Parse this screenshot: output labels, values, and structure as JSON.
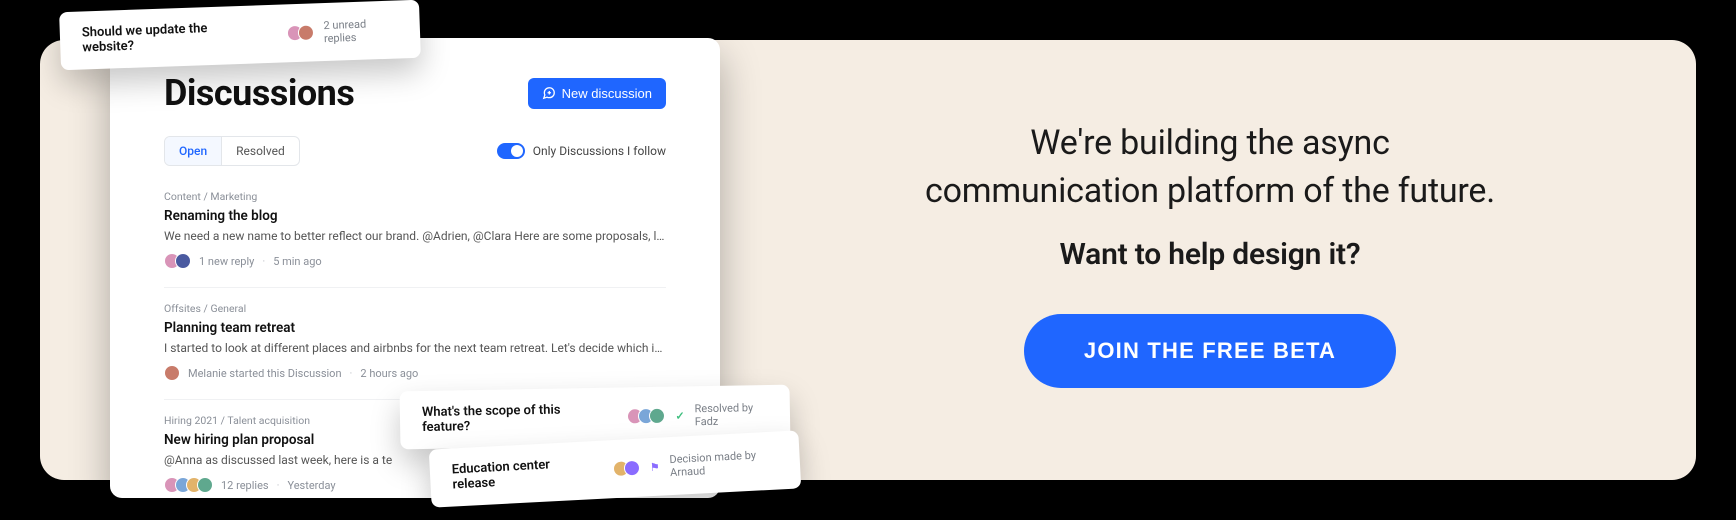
{
  "marketing": {
    "line1": "We're building the async",
    "line2": "communication platform of the future.",
    "line3": "Want to help design it?",
    "cta": "JOIN THE FREE BETA"
  },
  "app": {
    "title": "Discussions",
    "new_button": "New discussion",
    "tab_open": "Open",
    "tab_resolved": "Resolved",
    "follow_label": "Only Discussions I follow"
  },
  "items": [
    {
      "breadcrumb": "Content / Marketing",
      "title": "Renaming the blog",
      "snippet": "We need a new name to better reflect our brand. @Adrien, @Clara Here are some proposals, let m…",
      "meta1": "1 new reply",
      "meta2": "5 min ago",
      "avatars": [
        "#d994b8",
        "#4a5aa0"
      ]
    },
    {
      "breadcrumb": "Offsites / General",
      "title": "Planning team retreat",
      "snippet": "I started to look at different places and airbnbs for the next team retreat. Let's decide which is the b…",
      "meta1": "Melanie started this Discussion",
      "meta2": "2 hours ago",
      "avatars": [
        "#c87b6a"
      ]
    },
    {
      "breadcrumb": "Hiring 2021 / Talent acquisition",
      "title": "New hiring plan proposal",
      "snippet": "@Anna as discussed last week, here is a te",
      "meta1": "12 replies",
      "meta2": "Yesterday",
      "avatars": [
        "#d994b8",
        "#7aa6d8",
        "#e2b36a",
        "#5fa88e"
      ]
    }
  ],
  "toasts": {
    "t1": {
      "title": "Should we update the website?",
      "meta": "2 unread replies",
      "avatars": [
        "#d994b8",
        "#c87b6a"
      ]
    },
    "t2": {
      "title": "What's the scope of this feature?",
      "meta": "Resolved by Fadz",
      "avatars": [
        "#d994b8",
        "#7aa6d8",
        "#5fa88e"
      ]
    },
    "t3": {
      "title": "Education center release",
      "meta": "Decision made by Arnaud",
      "avatars": [
        "#e2b36a",
        "#8a6cff"
      ]
    }
  }
}
